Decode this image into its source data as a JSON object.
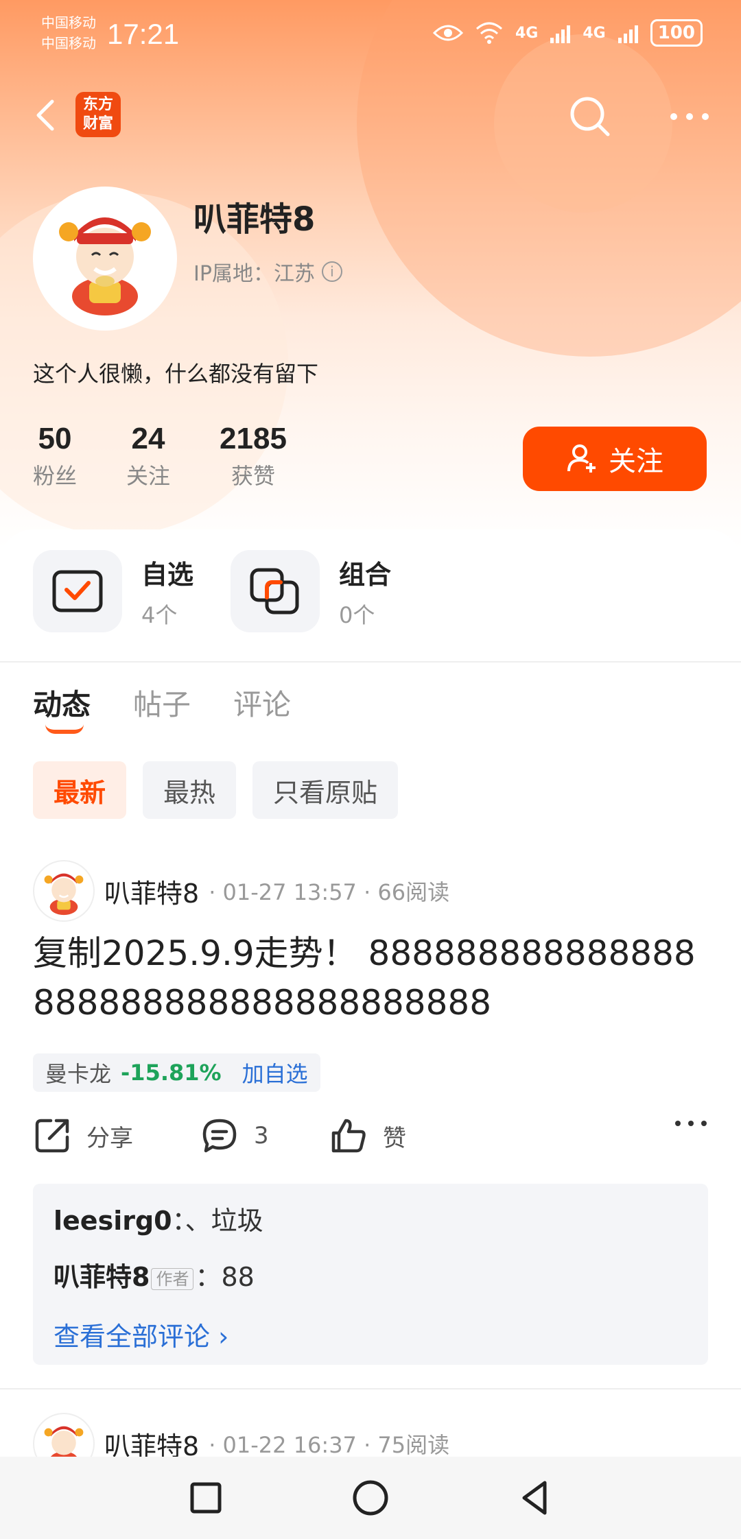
{
  "status_bar": {
    "carrier1": "中国移动",
    "carrier2": "中国移动",
    "time": "17:21",
    "net1": "4G",
    "net2": "4G",
    "battery": "100"
  },
  "nav": {
    "logo_line1": "东方",
    "logo_line2": "财富"
  },
  "profile": {
    "name": "叭菲特8",
    "ip_location": "IP属地：江苏",
    "bio": "这个人很懒，什么都没有留下",
    "stats": [
      {
        "value": "50",
        "label": "粉丝"
      },
      {
        "value": "24",
        "label": "关注"
      },
      {
        "value": "2185",
        "label": "获赞"
      }
    ],
    "follow_label": "关注"
  },
  "shortcuts": [
    {
      "title": "自选",
      "count": "4个"
    },
    {
      "title": "组合",
      "count": "0个"
    }
  ],
  "tabs": [
    "动态",
    "帖子",
    "评论"
  ],
  "filters": [
    "最新",
    "最热",
    "只看原贴"
  ],
  "posts": [
    {
      "author": "叭菲特8",
      "meta": "· 01-27 13:57 · 66阅读",
      "body": "复制2025.9.9走势！ 888888888888888888888888888888888888",
      "stock": {
        "name": "曼卡龙",
        "change": "-15.81%",
        "add_label": "加自选"
      },
      "actions": {
        "share": "分享",
        "comments": "3",
        "like": "赞"
      },
      "comments": [
        {
          "user": "leesirg0",
          "text": "、垃圾"
        },
        {
          "user": "叭菲特8",
          "tag": "作者",
          "text": "88"
        }
      ],
      "view_all": "查看全部评论 ›"
    },
    {
      "author": "叭菲特8",
      "meta": "· 01-22 16:37 · 75阅读"
    }
  ],
  "colors": {
    "accent": "#ff4a00",
    "stock_down": "#1ea35a",
    "link": "#2a6fd6"
  }
}
